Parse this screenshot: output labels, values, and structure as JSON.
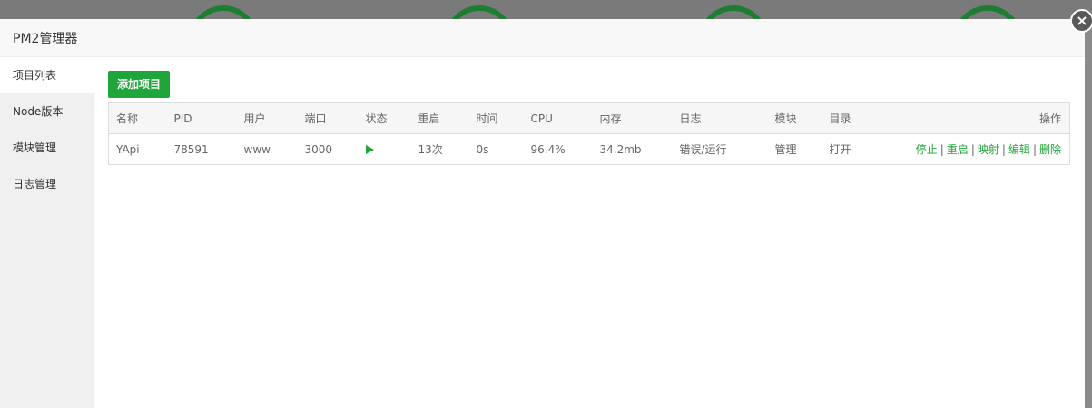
{
  "window": {
    "title": "PM2管理器",
    "close_icon": "close-icon"
  },
  "sidebar": {
    "items": [
      {
        "label": "项目列表",
        "active": true
      },
      {
        "label": "Node版本",
        "active": false
      },
      {
        "label": "模块管理",
        "active": false
      },
      {
        "label": "日志管理",
        "active": false
      }
    ]
  },
  "toolbar": {
    "add_label": "添加项目"
  },
  "table": {
    "headers": [
      "名称",
      "PID",
      "用户",
      "端口",
      "状态",
      "重启",
      "时间",
      "CPU",
      "内存",
      "日志",
      "模块",
      "目录",
      "操作"
    ],
    "rows": [
      {
        "name": "YApi",
        "pid": "78591",
        "user": "www",
        "port": "3000",
        "status_icon": "play-icon",
        "restarts": "13次",
        "time": "0s",
        "cpu": "96.4%",
        "memory": "34.2mb",
        "log": "错误/运行",
        "module": "管理",
        "dir": "打开",
        "ops": [
          "停止",
          "重启",
          "映射",
          "编辑",
          "删除"
        ],
        "op_separator": "|"
      }
    ]
  },
  "colors": {
    "accent": "#20a53a",
    "sidebar_bg": "#f0f0f0",
    "header_bg": "#f8f8f8"
  }
}
